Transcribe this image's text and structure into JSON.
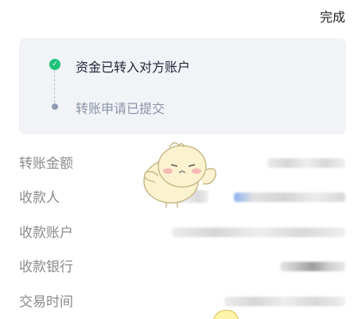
{
  "header": {
    "done_label": "完成"
  },
  "status": {
    "steps": [
      {
        "label": "资金已转入对方账户",
        "state": "done",
        "icon": "check-circle-icon",
        "color": "#1ec37a"
      },
      {
        "label": "转账申请已提交",
        "state": "done-muted",
        "icon": "dot-icon",
        "color": "#8f9bb3"
      }
    ]
  },
  "details": [
    {
      "label": "转账金额"
    },
    {
      "label": "收款人"
    },
    {
      "label": "收款账户"
    },
    {
      "label": "收款银行"
    },
    {
      "label": "交易时间"
    }
  ],
  "colors": {
    "accent_green": "#1ec37a",
    "card_background": "#f2f3f7",
    "label_gray": "#8a8a8a"
  }
}
